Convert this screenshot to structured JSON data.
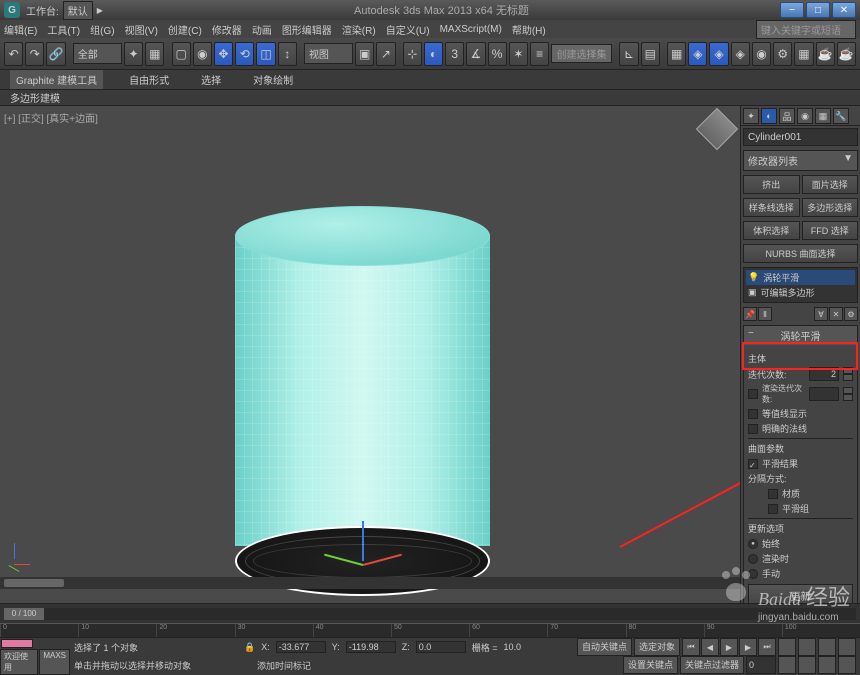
{
  "title": {
    "workspace_label": "工作台:",
    "workspace_value": "默认",
    "app_title": "Autodesk 3ds Max 2013 x64   无标题"
  },
  "menu": {
    "items": [
      "编辑(E)",
      "工具(T)",
      "组(G)",
      "视图(V)",
      "创建(C)",
      "修改器",
      "动画",
      "图形编辑器",
      "渲染(R)",
      "自定义(U)",
      "MAXScript(M)",
      "帮助(H)"
    ],
    "search_placeholder": "键入关键字或短语"
  },
  "toolbar": {
    "scope_dropdown": "全部",
    "view_dropdown": "视图",
    "selection_dropdown": "创建选择集"
  },
  "ribbon": {
    "tabs": [
      "Graphite 建模工具",
      "自由形式",
      "选择",
      "对象绘制"
    ],
    "subtab": "多边形建模"
  },
  "viewport": {
    "label": "[+] [正交] [真实+边面]"
  },
  "panel": {
    "object_name": "Cylinder001",
    "modifier_list_label": "修改器列表",
    "btn_row1": [
      "挤出",
      "面片选择"
    ],
    "btn_row2": [
      "样条线选择",
      "多边形选择"
    ],
    "btn_row3": [
      "体积选择",
      "FFD 选择"
    ],
    "btn_row4": "NURBS 曲面选择",
    "stack_items": [
      "涡轮平滑",
      "可编辑多边形"
    ],
    "rollout_title": "涡轮平滑",
    "main_label": "主体",
    "iterations_label": "迭代次数:",
    "iterations_value": "2",
    "render_iterations_label": "渲染迭代次数:",
    "render_iterations_value": "",
    "isoline_display": "等值线显示",
    "explicit_normals": "明确的法线",
    "surface_params": "曲面参数",
    "smooth_result": "平滑结果",
    "separate_by": "分隔方式:",
    "materials": "材质",
    "smoothing_groups": "平滑组",
    "update_options": "更新选项",
    "always": "始终",
    "when_rendering": "渲染时",
    "manually": "手动",
    "update_btn": "更新"
  },
  "timeline": {
    "current": "0 / 100",
    "ticks": [
      "0",
      "10",
      "20",
      "30",
      "40",
      "50",
      "60",
      "70",
      "80",
      "90",
      "100"
    ]
  },
  "status": {
    "welcome": "欢迎使用",
    "script_tab": "MAXS",
    "selection_info": "选择了 1 个对象",
    "hint": "单击并拖动以选择并移动对象",
    "x_label": "X:",
    "x_value": "-33.677",
    "y_label": "Y:",
    "y_value": "-119.98",
    "z_label": "Z:",
    "z_value": "0.0",
    "grid_label": "栅格 =",
    "grid_value": "10.0",
    "autokey": "自动关键点",
    "selected": "选定对象",
    "setkey": "设置关键点",
    "keyfilter": "关键点过滤器",
    "timetag": "添加时间标记"
  },
  "watermark": {
    "brand": "Baidu",
    "text": "经验",
    "url": "jingyan.baidu.com"
  }
}
